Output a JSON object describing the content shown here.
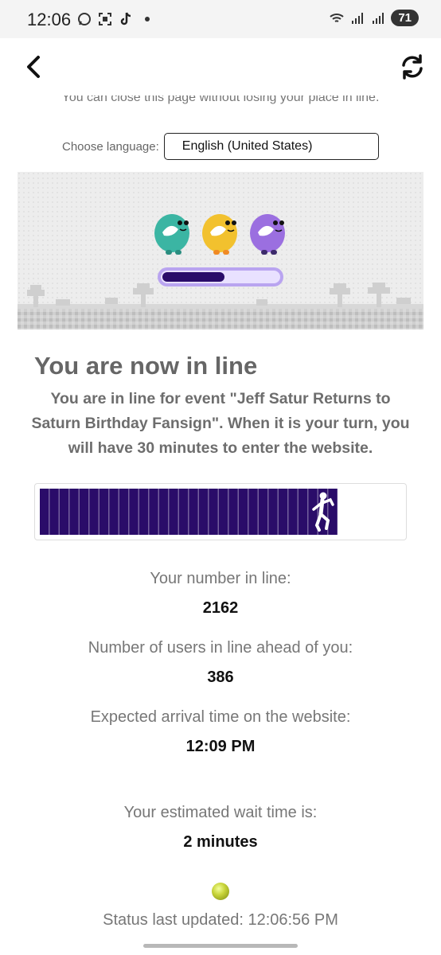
{
  "statusbar": {
    "time": "12:06",
    "battery": "71",
    "icons": [
      "chat-bubble-icon",
      "screenshot-icon",
      "tiktok-icon",
      "notification-dot-icon",
      "wifi-icon",
      "signal-icon",
      "signal-icon",
      "battery-icon"
    ]
  },
  "appbar": {
    "back_icon": "chevron-left-icon",
    "refresh_icon": "refresh-icon"
  },
  "page": {
    "close_message": "You can close this page without losing your place in line.",
    "language_label": "Choose language:",
    "language_value": "English (United States)",
    "headline": "You are now in line",
    "intro": "You are in line for event \"Jeff Satur Returns to Saturn Birthday Fansign\". When it is your turn, you will have 30 minutes to enter the website.",
    "progress_fraction": 0.82,
    "number_in_line_label": "Your number in line:",
    "number_in_line": "2162",
    "users_ahead_label": "Number of users in line ahead of you:",
    "users_ahead": "386",
    "arrival_label": "Expected arrival time on the website:",
    "arrival_time": "12:09 PM",
    "wait_label": "Your estimated wait time is:",
    "wait_time": "2 minutes",
    "status_updated": "Status last updated: 12:06:56 PM"
  },
  "colors": {
    "progress_fill": "#2a0c69",
    "mascot_teal": "#3bb5a3",
    "mascot_yellow": "#f2c12e",
    "mascot_purple": "#9b6fe0",
    "status_light": "#c8d43a"
  }
}
